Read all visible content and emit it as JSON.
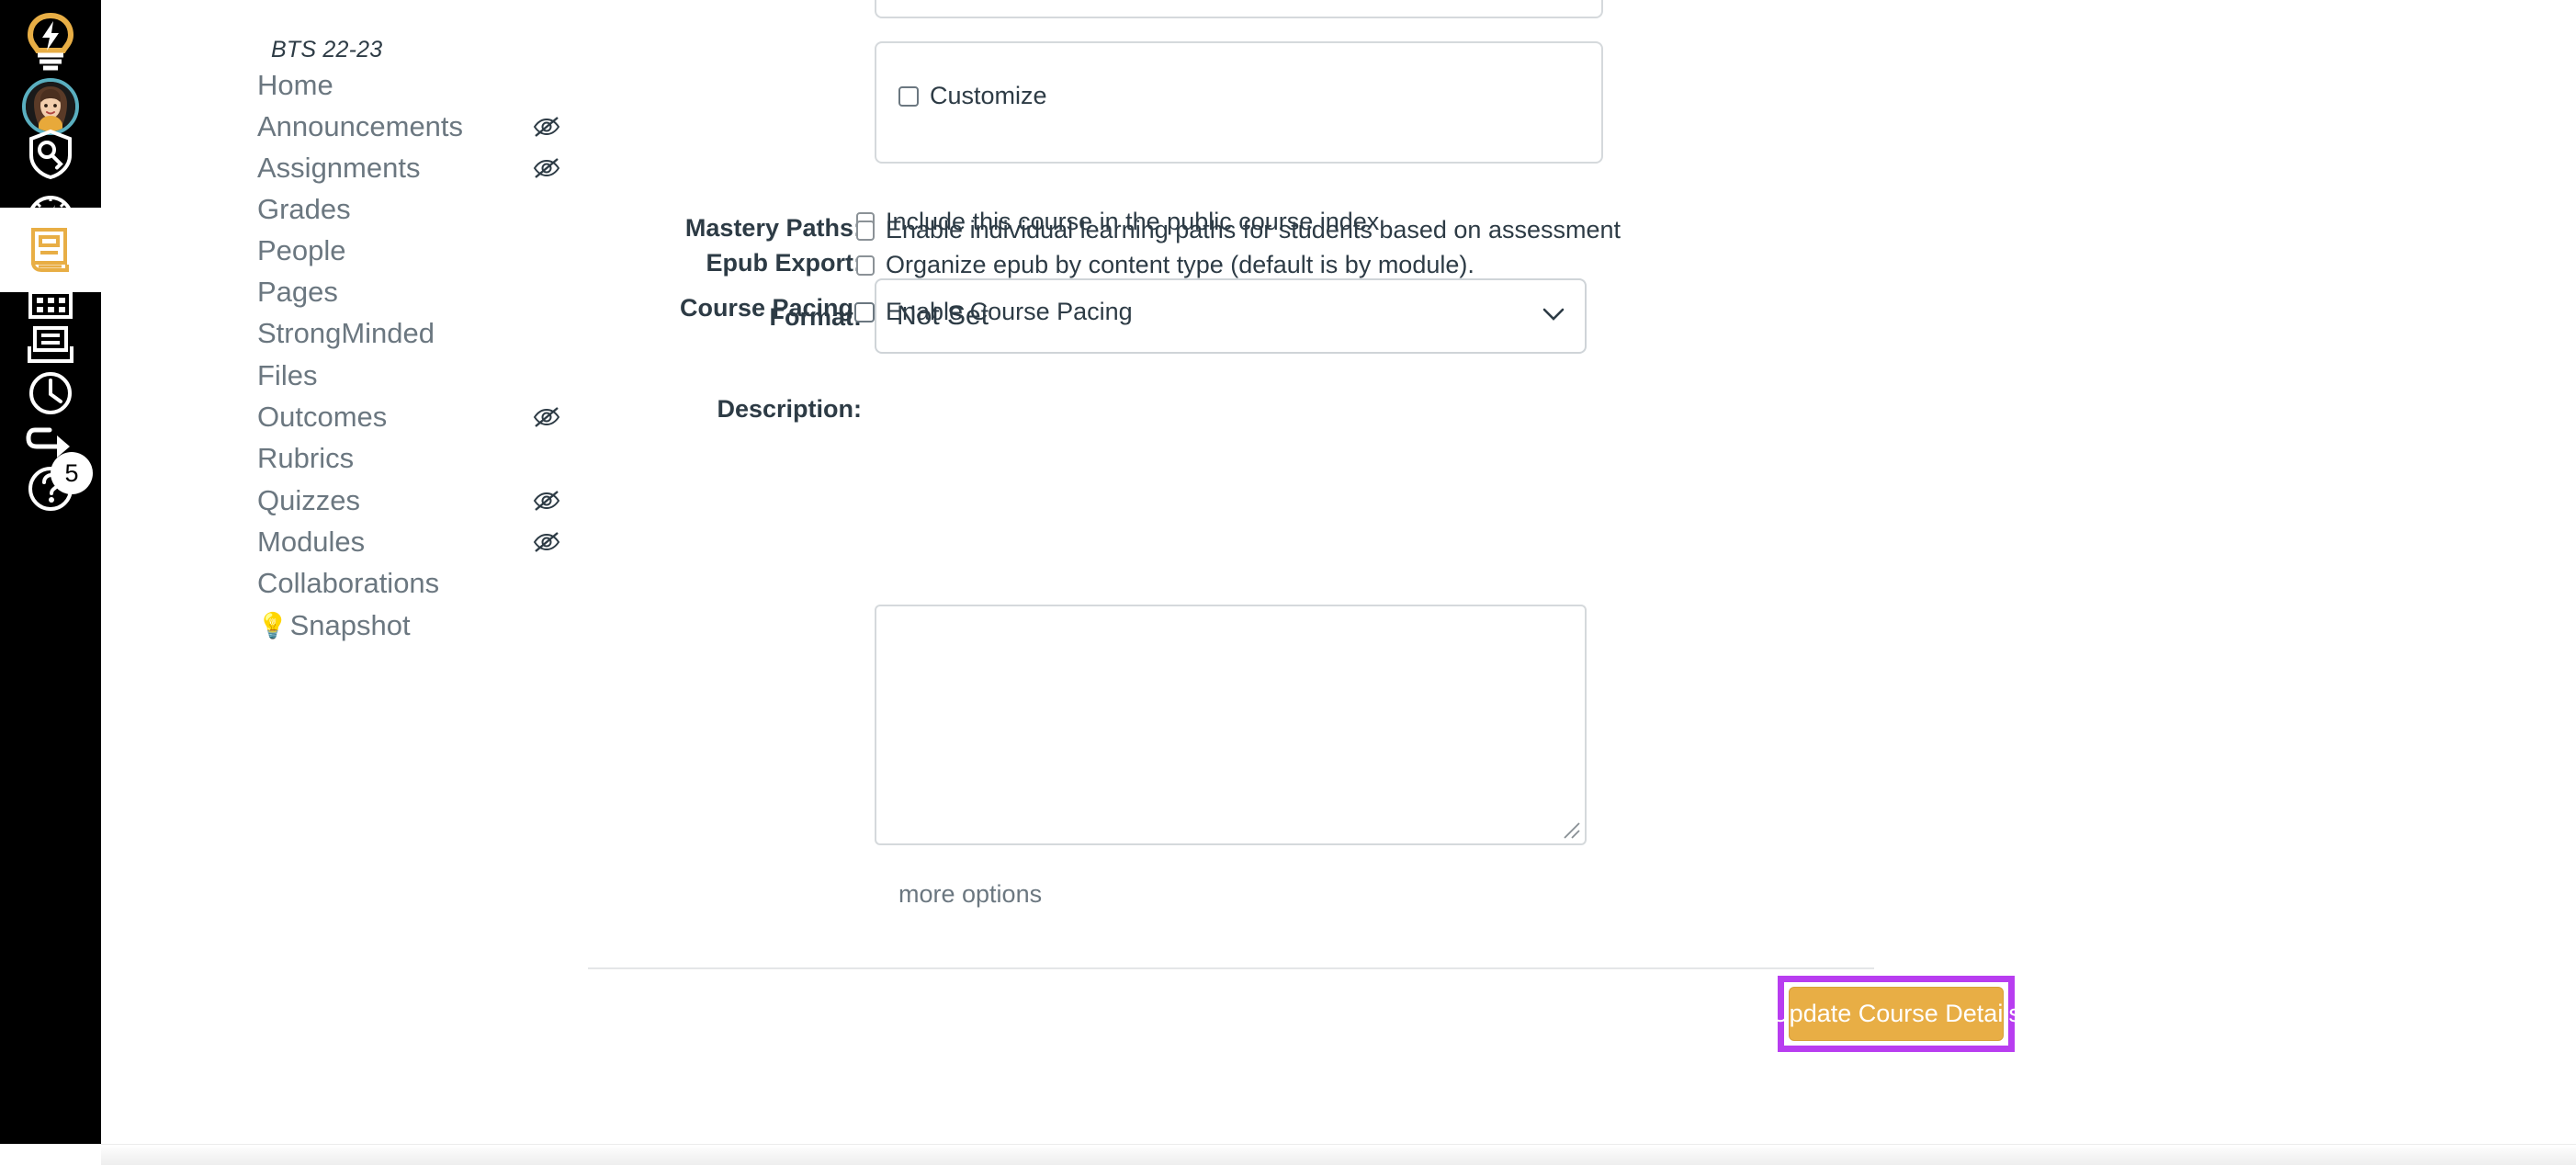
{
  "global_nav": {
    "items": [
      {
        "name": "logo-lightbulb",
        "icon": "lightbulb-icon",
        "label": "Home Logo",
        "active": false
      },
      {
        "name": "account",
        "icon": "avatar-icon",
        "label": "Account",
        "active": false
      },
      {
        "name": "admin",
        "icon": "shield-key-icon",
        "label": "Admin",
        "active": false
      },
      {
        "name": "dashboard",
        "icon": "gauge-icon",
        "label": "Dashboard",
        "active": false
      },
      {
        "name": "courses",
        "icon": "book-icon",
        "label": "Courses",
        "active": true
      },
      {
        "name": "calendar",
        "icon": "calendar-icon",
        "label": "Calendar",
        "active": false
      },
      {
        "name": "inbox",
        "icon": "inbox-icon",
        "label": "Inbox",
        "active": false
      },
      {
        "name": "history",
        "icon": "clock-icon",
        "label": "History",
        "active": false
      },
      {
        "name": "commons",
        "icon": "arrow-exit-icon",
        "label": "Commons",
        "active": false
      },
      {
        "name": "help",
        "icon": "question-mark-icon",
        "label": "Help",
        "active": false,
        "badge": "5"
      }
    ],
    "help_badge_count": "5"
  },
  "course_nav": {
    "term": "BTS 22-23",
    "items": [
      {
        "label": "Home",
        "hidden": false
      },
      {
        "label": "Announcements",
        "hidden": true
      },
      {
        "label": "Assignments",
        "hidden": true
      },
      {
        "label": "Grades",
        "hidden": false
      },
      {
        "label": "People",
        "hidden": false
      },
      {
        "label": "Pages",
        "hidden": false
      },
      {
        "label": "StrongMinded",
        "hidden": false
      },
      {
        "label": "Files",
        "hidden": false
      },
      {
        "label": "Outcomes",
        "hidden": true
      },
      {
        "label": "Rubrics",
        "hidden": false
      },
      {
        "label": "Quizzes",
        "hidden": true
      },
      {
        "label": "Modules",
        "hidden": true
      },
      {
        "label": "Collaborations",
        "hidden": false
      },
      {
        "label": "Snapshot",
        "hidden": false,
        "emoji": "💡"
      }
    ]
  },
  "form": {
    "customize_checkbox_label": "Customize",
    "public_index_checkbox_label": "Include this course in the public course index",
    "format_label": "Format:",
    "format_value": "Not Set",
    "mastery_paths_label": "Mastery Paths:",
    "mastery_paths_checkbox_label": "Enable individual learning paths for students based on assessment",
    "epub_export_label": "Epub Export:",
    "epub_export_checkbox_label": "Organize epub by content type (default is by module).",
    "course_pacing_label": "Course Pacing:",
    "course_pacing_checkbox_label": "Enable Course Pacing",
    "description_label": "Description:",
    "description_value": "",
    "more_options_link": "more options",
    "update_button_label": "Update Course Details"
  },
  "colors": {
    "accent_orange": "#e8ae45",
    "highlight_purple": "#b83df0",
    "nav_black": "#000000",
    "avatar_ring_teal": "#5aafc0",
    "text_gray": "#6b7780",
    "text_dark": "#2d3b45"
  }
}
